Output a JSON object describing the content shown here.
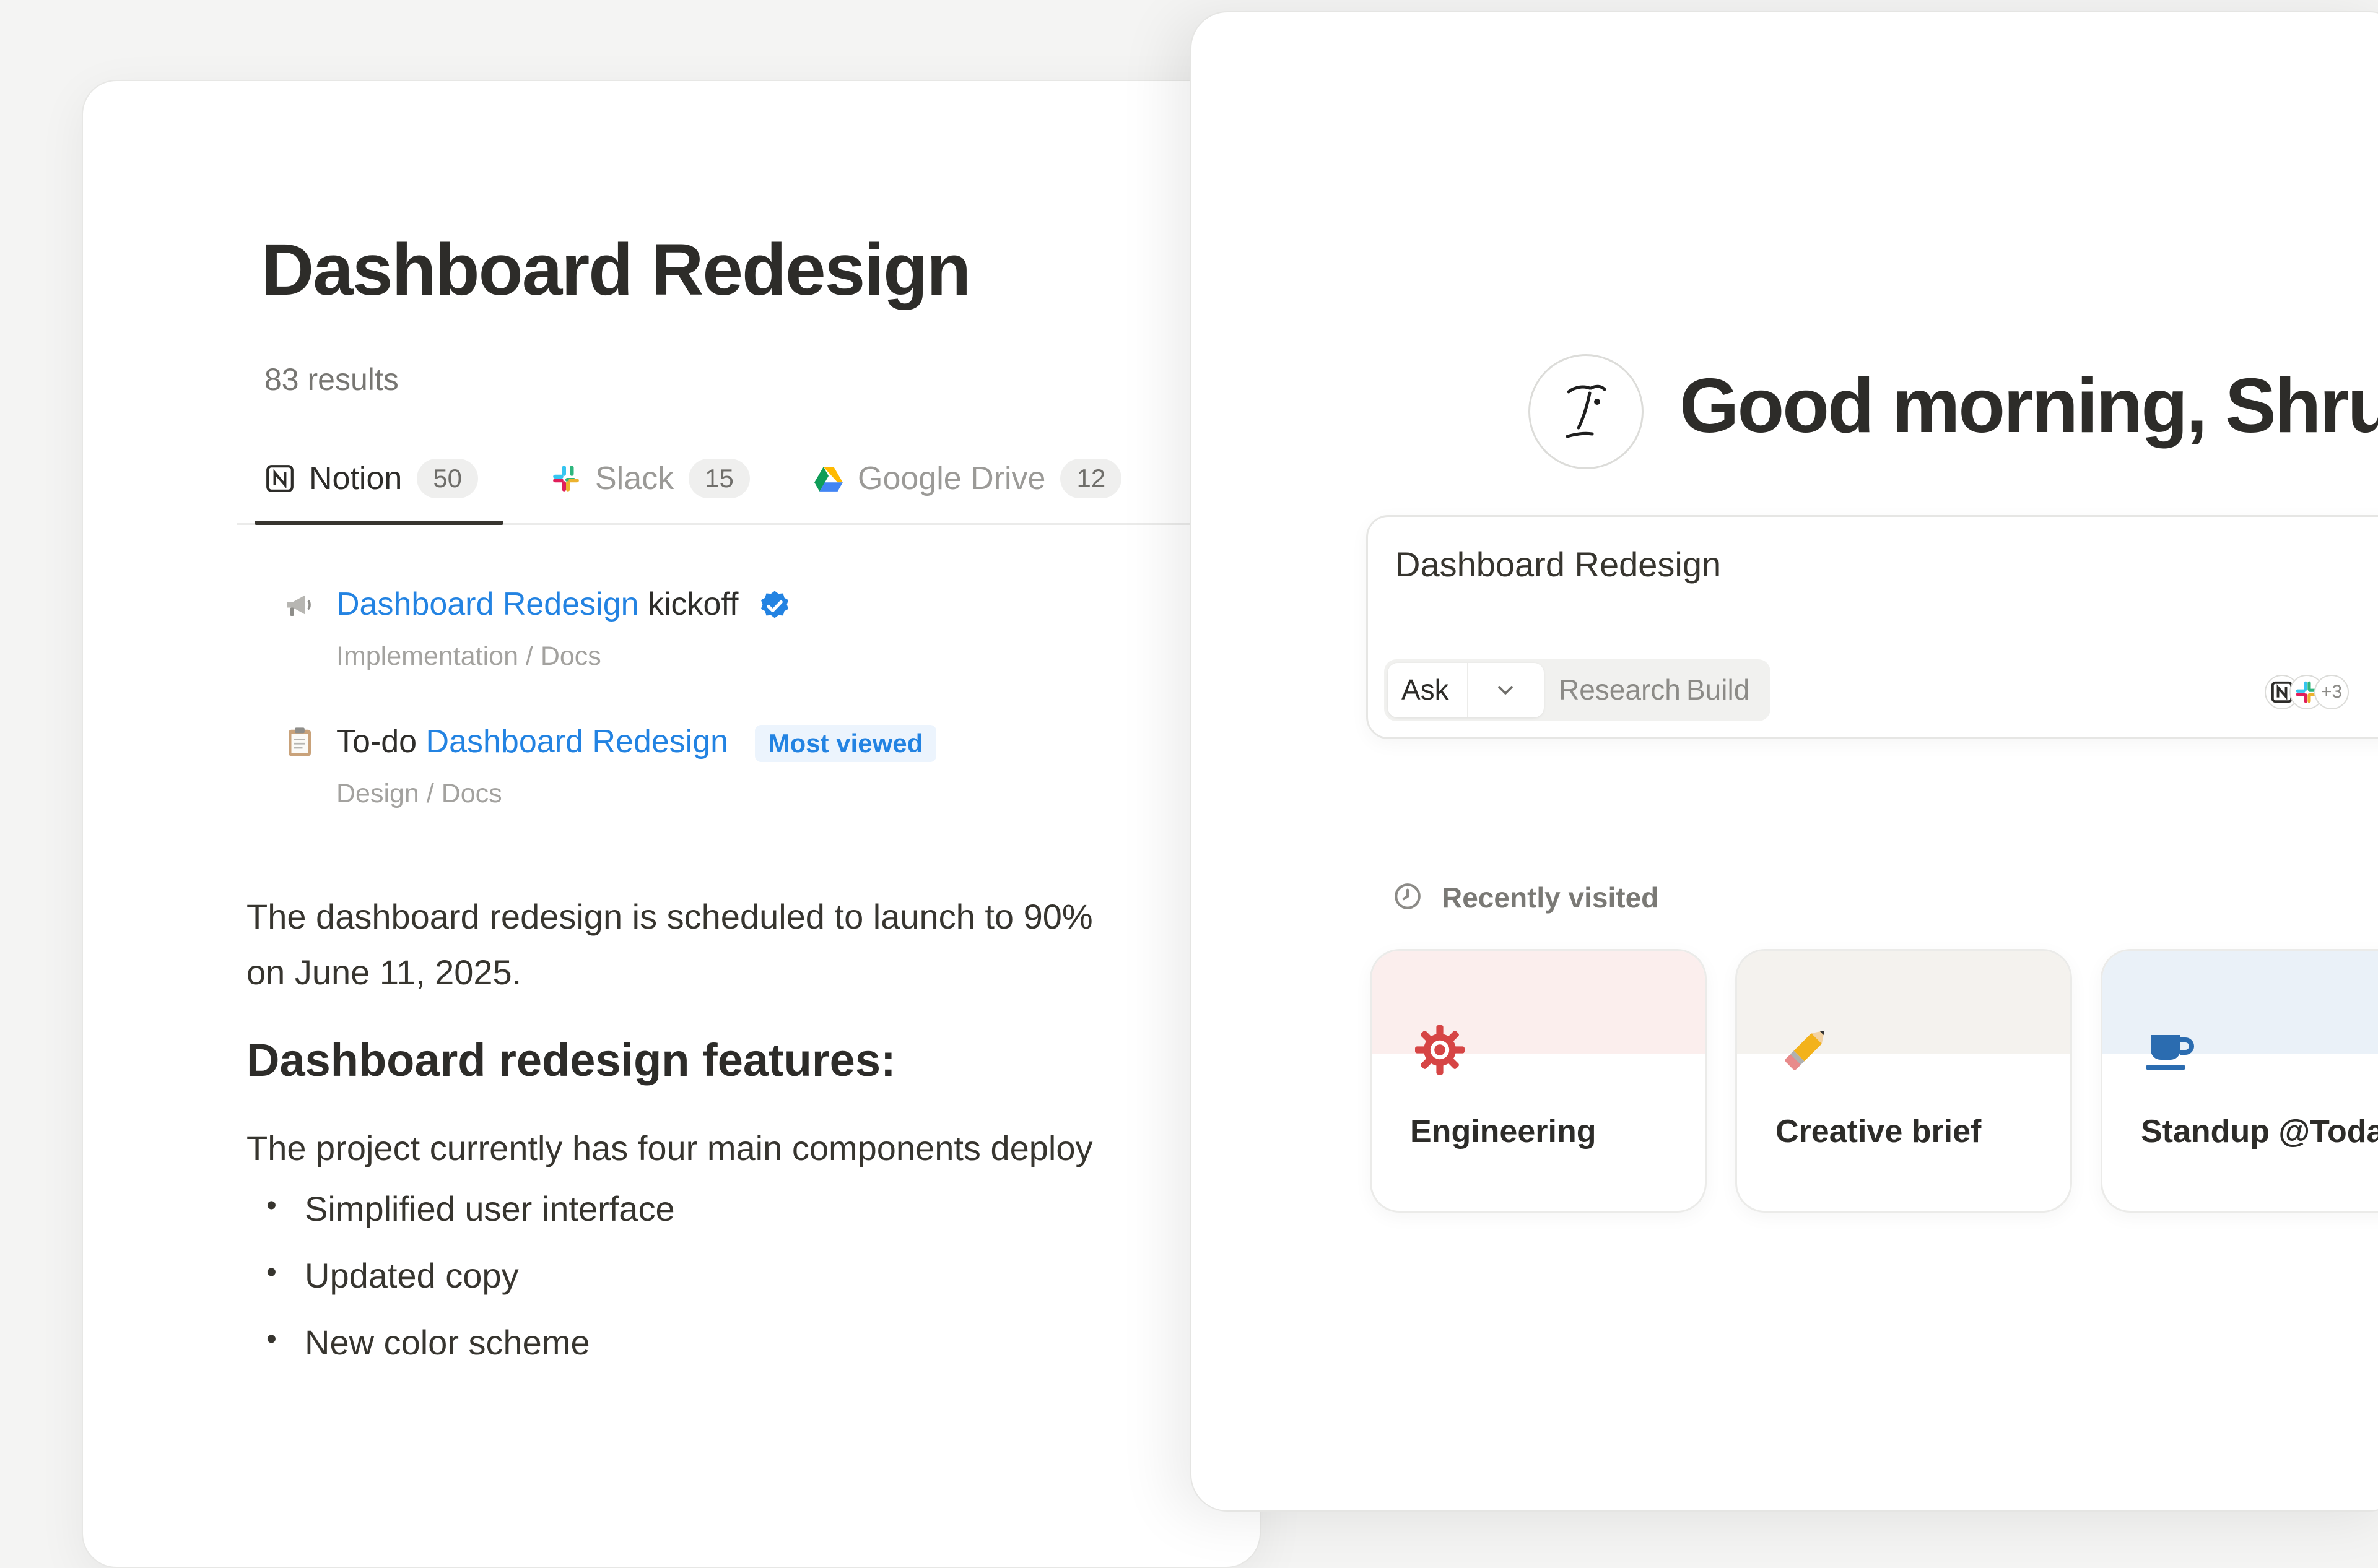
{
  "search_panel": {
    "title": "Dashboard Redesign",
    "results_count": "83 results",
    "tabs": [
      {
        "label": "Notion",
        "count": "50",
        "icon": "notion-icon",
        "active": true
      },
      {
        "label": "Slack",
        "count": "15",
        "icon": "slack-icon",
        "active": false
      },
      {
        "label": "Google Drive",
        "count": "12",
        "icon": "google-drive-icon",
        "active": false
      }
    ],
    "results": [
      {
        "icon": "megaphone-icon",
        "title_highlight": "Dashboard Redesign",
        "title_suffix": "kickoff",
        "verified": true,
        "path": "Implementation / Docs"
      },
      {
        "icon": "clipboard-icon",
        "title_prefix": "To-do",
        "title_highlight": "Dashboard Redesign",
        "tag": "Most viewed",
        "path": "Design / Docs"
      }
    ],
    "summary_line_1": "The dashboard redesign is scheduled to launch to 90%",
    "summary_line_2": "on June 11, 2025.",
    "features_heading": "Dashboard redesign features:",
    "features_intro": "The project currently has four main components deploy",
    "features": [
      "Simplified user interface",
      "Updated copy",
      "New color scheme"
    ]
  },
  "home_panel": {
    "greeting": "Good morning, Shruti",
    "ask_input_value": "Dashboard Redesign",
    "modes": {
      "ask": "Ask",
      "research": "Research",
      "build": "Build"
    },
    "source_icons": [
      "notion-icon",
      "slack-icon"
    ],
    "extra_sources": "+3",
    "recent_label": "Recently visited",
    "recent_cards": [
      {
        "title": "Engineering",
        "icon": "gear-icon",
        "band_color": "#fbeeed"
      },
      {
        "title": "Creative brief",
        "icon": "pencil-icon",
        "band_color": "#f4f2ee"
      },
      {
        "title": "Standup @Toda",
        "icon": "coffee-cup-icon",
        "band_color": "#eaf1f8"
      }
    ]
  },
  "colors": {
    "accent_blue": "#2383e2",
    "text": "#37352f",
    "muted": "#a3a29f"
  }
}
